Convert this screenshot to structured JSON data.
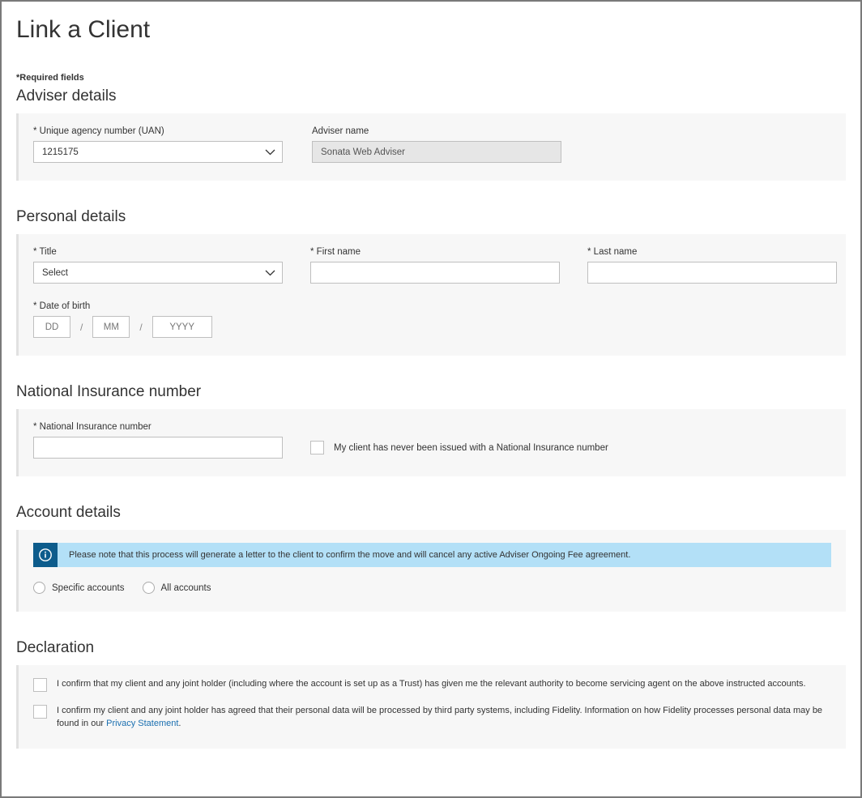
{
  "page_title": "Link a Client",
  "required_note": "*Required fields",
  "sections": {
    "adviser": {
      "title": "Adviser details",
      "uan_label": "* Unique agency number (UAN)",
      "uan_value": "1215175",
      "adviser_name_label": "Adviser name",
      "adviser_name_value": "Sonata Web Adviser"
    },
    "personal": {
      "title": "Personal details",
      "title_label": "* Title",
      "title_value": "Select",
      "first_name_label": "* First name",
      "first_name_value": "",
      "last_name_label": "* Last name",
      "last_name_value": "",
      "dob_label": "* Date of birth",
      "dob_dd_placeholder": "DD",
      "dob_mm_placeholder": "MM",
      "dob_yyyy_placeholder": "YYYY",
      "dob_sep": "/"
    },
    "ni": {
      "title": "National Insurance number",
      "field_label": "* National Insurance number",
      "value": "",
      "checkbox_label": "My client has never been issued with a National Insurance number"
    },
    "account": {
      "title": "Account details",
      "info_text": "Please note that this process will generate a letter to the client to confirm the move and will cancel any active Adviser Ongoing Fee agreement.",
      "radio_specific": "Specific accounts",
      "radio_all": "All accounts"
    },
    "declaration": {
      "title": "Declaration",
      "item1": "I confirm that my client and any joint holder (including where the account is set up as a Trust) has given me the relevant authority to become servicing agent on the above instructed accounts.",
      "item2a": "I confirm my client and any joint holder has agreed that their personal data will be processed by third party systems, including Fidelity. Information on how Fidelity processes personal data may be found in our ",
      "item2_link": "Privacy Statement",
      "item2b": "."
    }
  }
}
